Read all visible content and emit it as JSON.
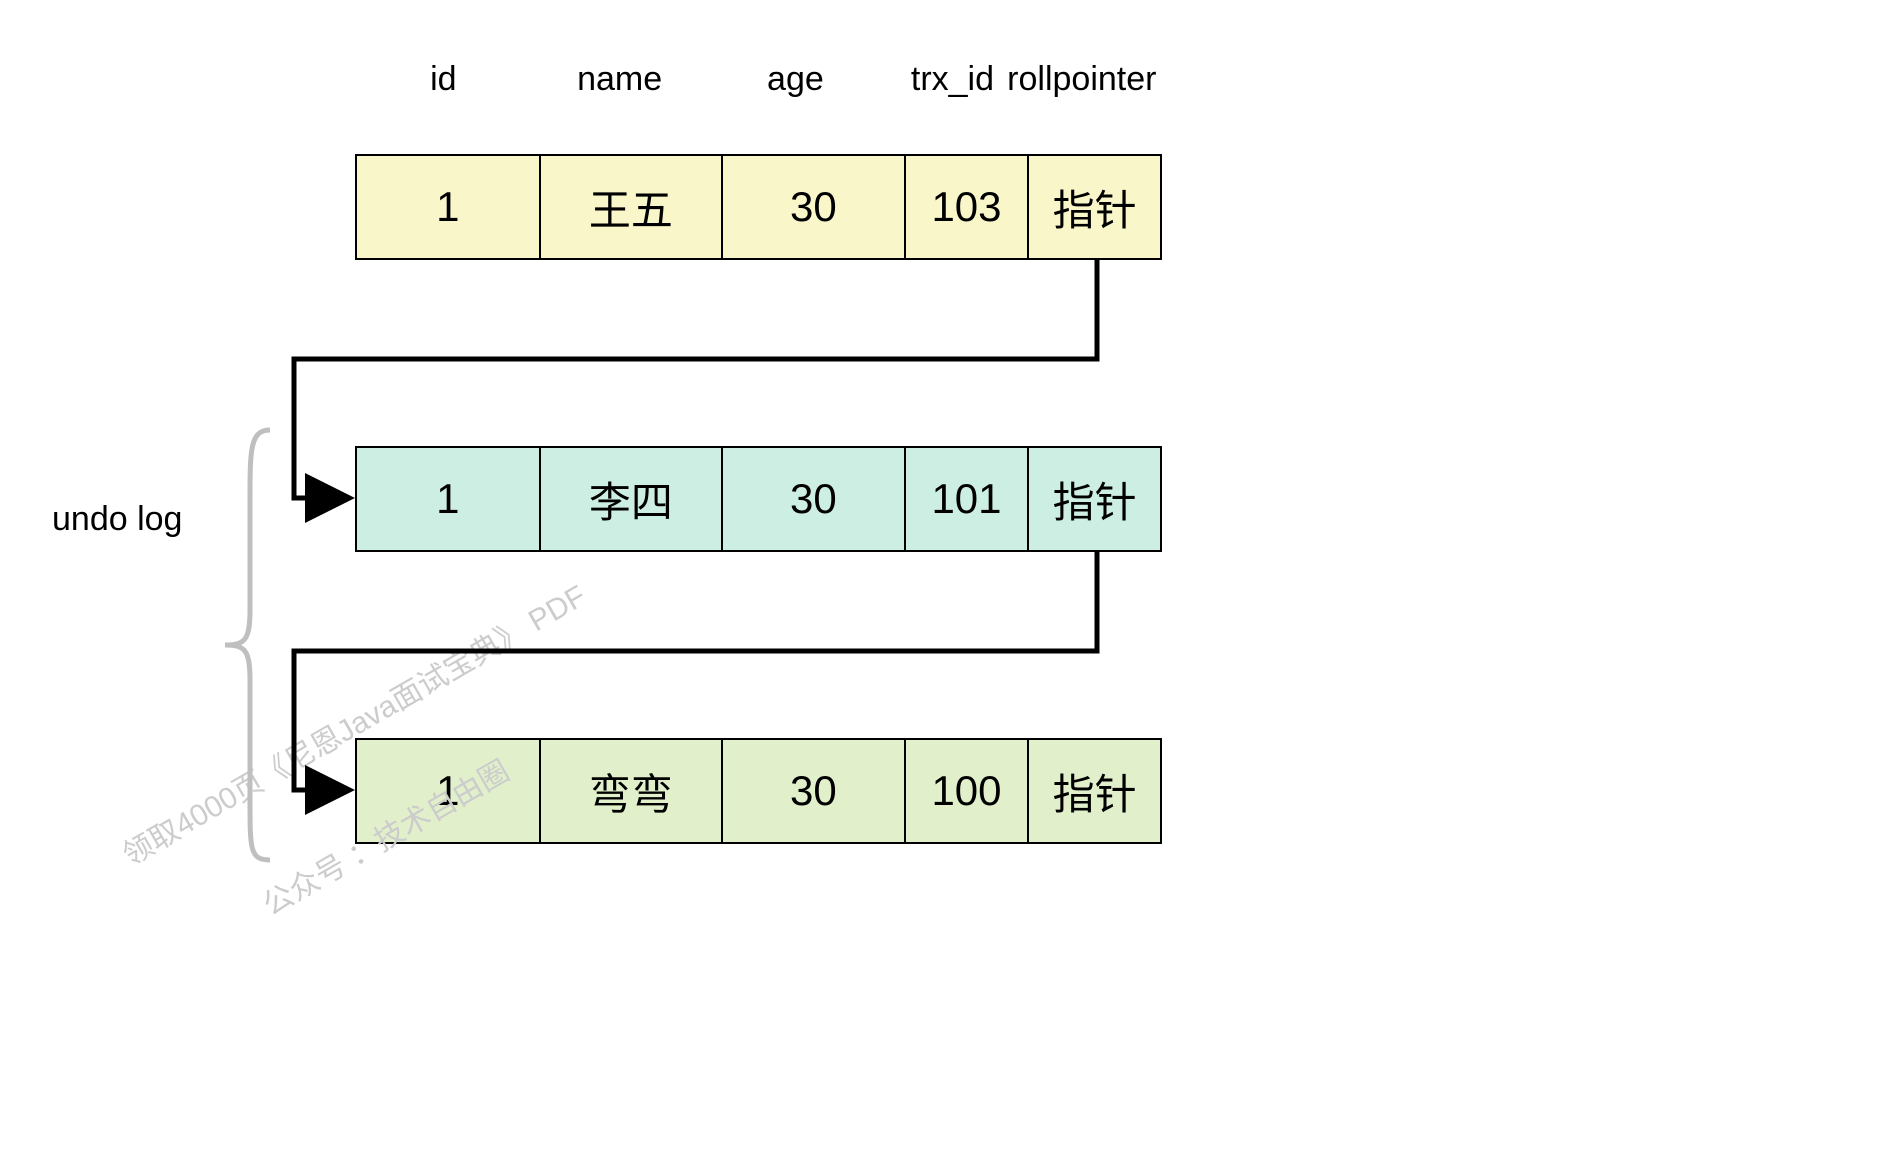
{
  "headers": {
    "id": "id",
    "name": "name",
    "age": "age",
    "trx_id": "trx_id",
    "rollpointer": "rollpointer"
  },
  "rows": [
    {
      "id": "1",
      "name": "王五",
      "age": "30",
      "trx_id": "103",
      "rollpointer": "指针",
      "color": "yellow"
    },
    {
      "id": "1",
      "name": "李四",
      "age": "30",
      "trx_id": "101",
      "rollpointer": "指针",
      "color": "teal"
    },
    {
      "id": "1",
      "name": "弯弯",
      "age": "30",
      "trx_id": "100",
      "rollpointer": "指针",
      "color": "green"
    }
  ],
  "labels": {
    "undo_log": "undo log"
  },
  "watermarks": {
    "line1": "领取4000页《尼恩Java面试宝典》 PDF",
    "line2": "公众号 ：技术自由圈"
  }
}
